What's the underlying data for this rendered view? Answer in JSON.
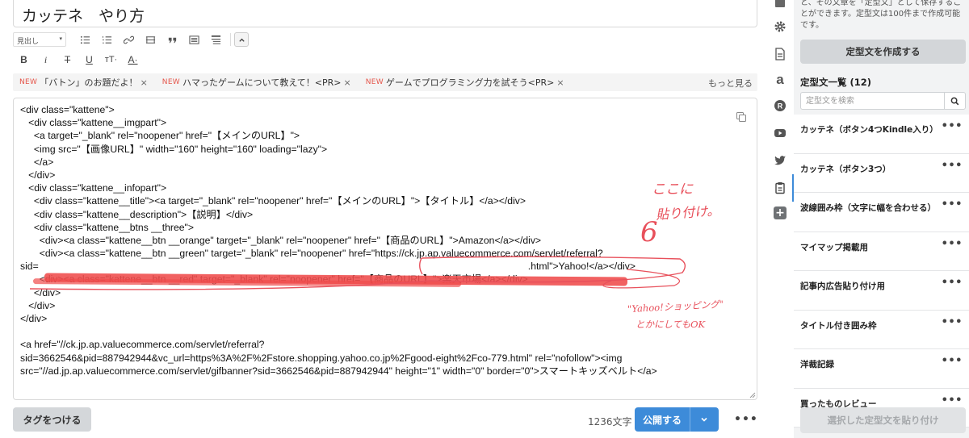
{
  "editor": {
    "title": "カッテネ　やり方",
    "heading_select": "見出し",
    "tags": [
      {
        "badge": "NEW",
        "label": "「バトン」のお題だよ！",
        "close": "×"
      },
      {
        "badge": "NEW",
        "label": "ハマったゲームについて教えて！<PR>",
        "close": "×"
      },
      {
        "badge": "NEW",
        "label": "ゲームでプログラミング力を試そう<PR>",
        "close": "×"
      }
    ],
    "more_link": "もっと見る",
    "code_lines": [
      "<div class=\"kattene\">",
      "   <div class=\"kattene__imgpart\">",
      "     <a target=\"_blank\" rel=\"noopener\" href=\"【メインのURL】\">",
      "     <img src=\"【画像URL】\" width=\"160\" height=\"160\" loading=\"lazy\">",
      "     </a>",
      "   </div>",
      "   <div class=\"kattene__infopart\">",
      "     <div class=\"kattene__title\"><a target=\"_blank\" rel=\"noopener\" href=\"【メインのURL】\">【タイトル】</a></div>",
      "     <div class=\"kattene__description\">【説明】</div>",
      "     <div class=\"kattene__btns __three\">",
      "       <div><a class=\"kattene__btn __orange\" target=\"_blank\" rel=\"noopener\" href=\"【商品のURL】\">Amazon</a></div>",
      "       <div><a class=\"kattene__btn __green\" target=\"_blank\" rel=\"noopener\" href=\"https://ck.jp.ap.valuecommerce.com/servlet/referral?",
      "sid=                                                                                                                                                                                   .html\">Yahoo!</a></div>",
      "       <div><a class=\"kattene__btn __red\" target=\"_blank\" rel=\"noopener\" href=\"【商品のURL】\">楽天市場</a></div>",
      "     </div>",
      "   </div>",
      "</div>",
      "",
      "<a href=\"//ck.jp.ap.valuecommerce.com/servlet/referral?",
      "sid=3662546&pid=887942944&vc_url=https%3A%2F%2Fstore.shopping.yahoo.co.jp%2Fgood-eight%2Fco-779.html\" rel=\"nofollow\"><img",
      "src=\"//ad.jp.ap.valuecommerce.com/servlet/gifbanner?sid=3662546&pid=887942944\" height=\"1\" width=\"0\" border=\"0\">スマートキッズベルト</a>"
    ],
    "annotations": {
      "paste_here_1": "ここに",
      "paste_here_2": "貼り付け。",
      "number": "6",
      "yahoo_note_1": "\"Yahoo!ショッピング\"",
      "yahoo_note_2": "とかにしてもOK"
    },
    "tag_button": "タグをつける",
    "char_count": "1236文字",
    "publish_button": "公開する",
    "more_menu": "•••"
  },
  "panel": {
    "description": "と、その文章を「定型文」として保存することができます。定型文は100件まで作成可能です。",
    "create_button": "定型文を作成する",
    "list_title": "定型文一覧 (12)",
    "search_placeholder": "定型文を検索",
    "items": [
      {
        "name": "カッテネ（ボタン4つKindle入り）"
      },
      {
        "name": "カッテネ（ボタン3つ）"
      },
      {
        "name": "波線囲み枠（文字に幅を合わせる）"
      },
      {
        "name": "マイマップ掲載用"
      },
      {
        "name": "記事内広告貼り付け用"
      },
      {
        "name": "タイトル付き囲み枠"
      },
      {
        "name": "洋裁記録"
      },
      {
        "name": "買ったものレビュー"
      }
    ],
    "item_menu": "•••",
    "paste_button": "選択した定型文を貼り付け"
  },
  "colors": {
    "accent": "#3d8bd9",
    "annotation": "#e8505b",
    "new_badge": "#e5564b"
  },
  "icons": [
    "list-icon",
    "ordered-list-icon",
    "link-icon",
    "table-icon",
    "quote-icon",
    "box-icon",
    "lines-icon",
    "collapse-icon",
    "gear-icon",
    "document-icon",
    "amazon-icon",
    "rakuten-icon",
    "youtube-icon",
    "twitter-icon",
    "clipboard-icon",
    "plus-icon",
    "search-icon",
    "copy-icon"
  ]
}
